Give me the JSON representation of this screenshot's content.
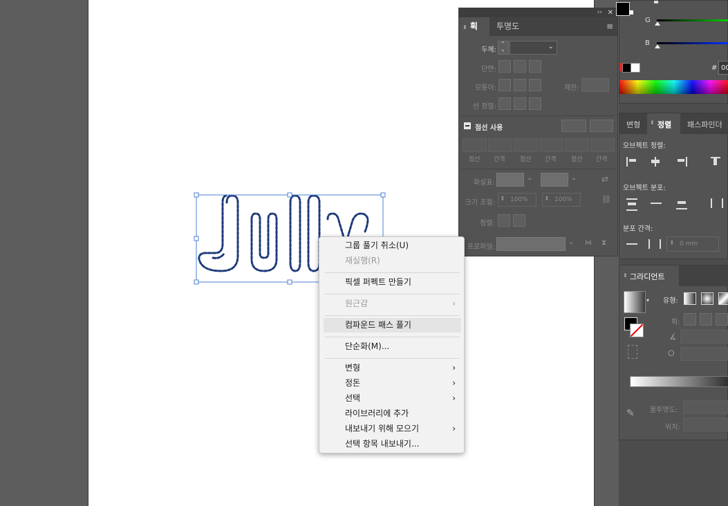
{
  "canvas": {
    "text_art": "July"
  },
  "stroke_panel": {
    "tabs": [
      "획",
      "투명도"
    ],
    "weight_label": "두께:",
    "cap_label": "단면:",
    "corner_label": "모퉁이:",
    "limit_label": "제한:",
    "align_label": "선 정렬:",
    "dashed_label": "점선 사용",
    "dash_cols": [
      "점선",
      "간격",
      "점선",
      "간격",
      "점선",
      "간격"
    ],
    "arrowheads_label": "화살표:",
    "scale_label": "크기 조절:",
    "scale_values": [
      "100%",
      "100%"
    ],
    "align2_label": "정렬:",
    "profile_label": "프로파일:"
  },
  "color_panel": {
    "g_label": "G",
    "b_label": "B",
    "hex_prefix": "#",
    "hex_value": "00"
  },
  "align_panel": {
    "tabs": [
      "변형",
      "정렬",
      "패스파인더"
    ],
    "align_objects": "오브젝트 정렬:",
    "distribute_objects": "오브젝트 분포:",
    "distribute_spacing": "분포 간격:",
    "spacing_value": "0 mm"
  },
  "gradient_panel": {
    "title": "그라디언트",
    "type_label": "유형:",
    "stroke_label": "획:",
    "opacity_label": "불투명도:",
    "location_label": "위치:"
  },
  "context_menu": {
    "items": [
      {
        "label": "그룹 풀기 취소(U)",
        "disabled": false,
        "submenu": false
      },
      {
        "label": "재실행(R)",
        "disabled": true,
        "submenu": false
      },
      {
        "label": "픽셀 퍼펙트 만들기",
        "disabled": false,
        "submenu": false
      },
      {
        "label": "원근감",
        "disabled": true,
        "submenu": true
      },
      {
        "label": "컴파운드 패스 풀기",
        "disabled": false,
        "submenu": false
      },
      {
        "label": "단순화(M)...",
        "disabled": false,
        "submenu": false
      },
      {
        "label": "변형",
        "disabled": false,
        "submenu": true
      },
      {
        "label": "정돈",
        "disabled": false,
        "submenu": true
      },
      {
        "label": "선택",
        "disabled": false,
        "submenu": true
      },
      {
        "label": "라이브러리에 추가",
        "disabled": false,
        "submenu": false
      },
      {
        "label": "내보내기 위해 모으기",
        "disabled": false,
        "submenu": true
      },
      {
        "label": "선택 항목 내보내기...",
        "disabled": false,
        "submenu": false
      }
    ],
    "submenu_arrow": "›"
  },
  "colors": {
    "accent_selection": "#4a7fd6",
    "art_stroke": "#1f3a7a"
  }
}
